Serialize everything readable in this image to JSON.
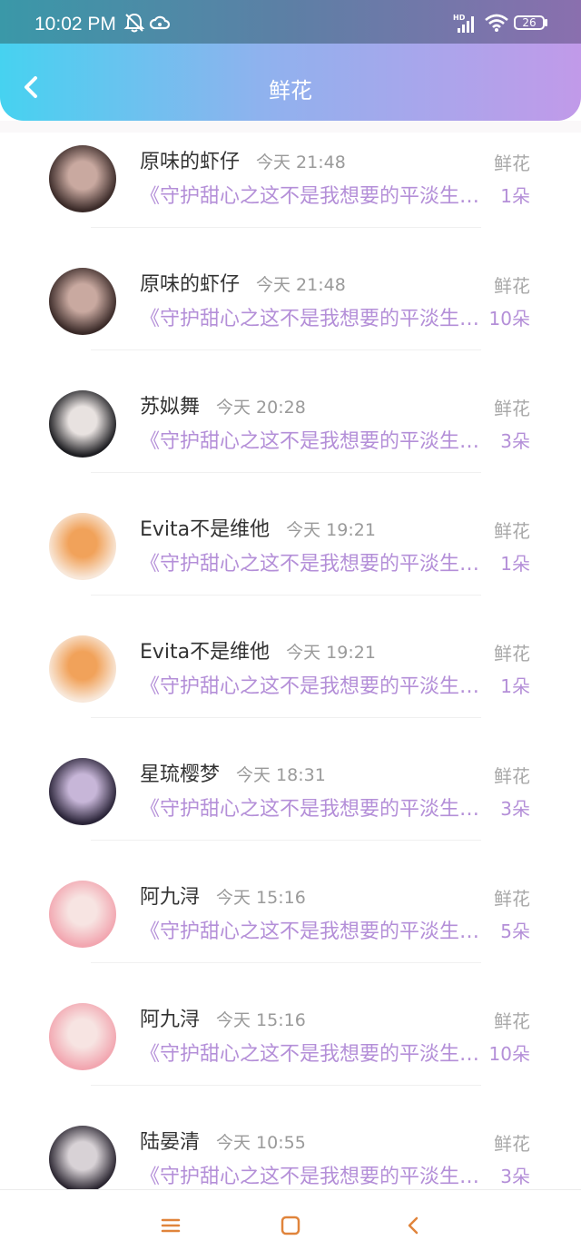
{
  "status_bar": {
    "time": "10:02 PM",
    "network_badge": "HD",
    "battery_level": "26"
  },
  "header": {
    "title": "鲜花",
    "gradient_colors": [
      "#46d2f0",
      "#c19ae9"
    ]
  },
  "gift_label": "鲜花",
  "rows": [
    {
      "name": "原味的虾仔",
      "time": "今天 21:48",
      "book": "《守护甜心之这不是我想要的平淡生活》",
      "count": "1朵",
      "avatar_colors": [
        "#3a2a28",
        "#c9a9a0"
      ]
    },
    {
      "name": "原味的虾仔",
      "time": "今天 21:48",
      "book": "《守护甜心之这不是我想要的平淡生活》",
      "count": "10朵",
      "avatar_colors": [
        "#3a2a28",
        "#c9a9a0"
      ]
    },
    {
      "name": "苏姒舞",
      "time": "今天 20:28",
      "book": "《守护甜心之这不是我想要的平淡生活》",
      "count": "3朵",
      "avatar_colors": [
        "#1e1e22",
        "#e8e2e0"
      ]
    },
    {
      "name": "Evita不是维他",
      "time": "今天 19:21",
      "book": "《守护甜心之这不是我想要的平淡生活》",
      "count": "1朵",
      "avatar_colors": [
        "#f8e8da",
        "#f1a25a"
      ]
    },
    {
      "name": "Evita不是维他",
      "time": "今天 19:21",
      "book": "《守护甜心之这不是我想要的平淡生活》",
      "count": "1朵",
      "avatar_colors": [
        "#f8e8da",
        "#f1a25a"
      ]
    },
    {
      "name": "星琉樱梦",
      "time": "今天 18:31",
      "book": "《守护甜心之这不是我想要的平淡生活》",
      "count": "3朵",
      "avatar_colors": [
        "#2a2438",
        "#c7b6d8"
      ]
    },
    {
      "name": "阿九浔",
      "time": "今天 15:16",
      "book": "《守护甜心之这不是我想要的平淡生活》",
      "count": "5朵",
      "avatar_colors": [
        "#f2a6b0",
        "#f7e4e2"
      ]
    },
    {
      "name": "阿九浔",
      "time": "今天 15:16",
      "book": "《守护甜心之这不是我想要的平淡生活》",
      "count": "10朵",
      "avatar_colors": [
        "#f2a6b0",
        "#f7e4e2"
      ]
    },
    {
      "name": "陆晏清",
      "time": "今天 10:55",
      "book": "《守护甜心之这不是我想要的平淡生活》",
      "count": "3朵",
      "avatar_colors": [
        "#2a2530",
        "#d8d2d6"
      ]
    }
  ],
  "nav_icons": [
    "menu-icon",
    "home-square-icon",
    "back-chevron-icon"
  ]
}
